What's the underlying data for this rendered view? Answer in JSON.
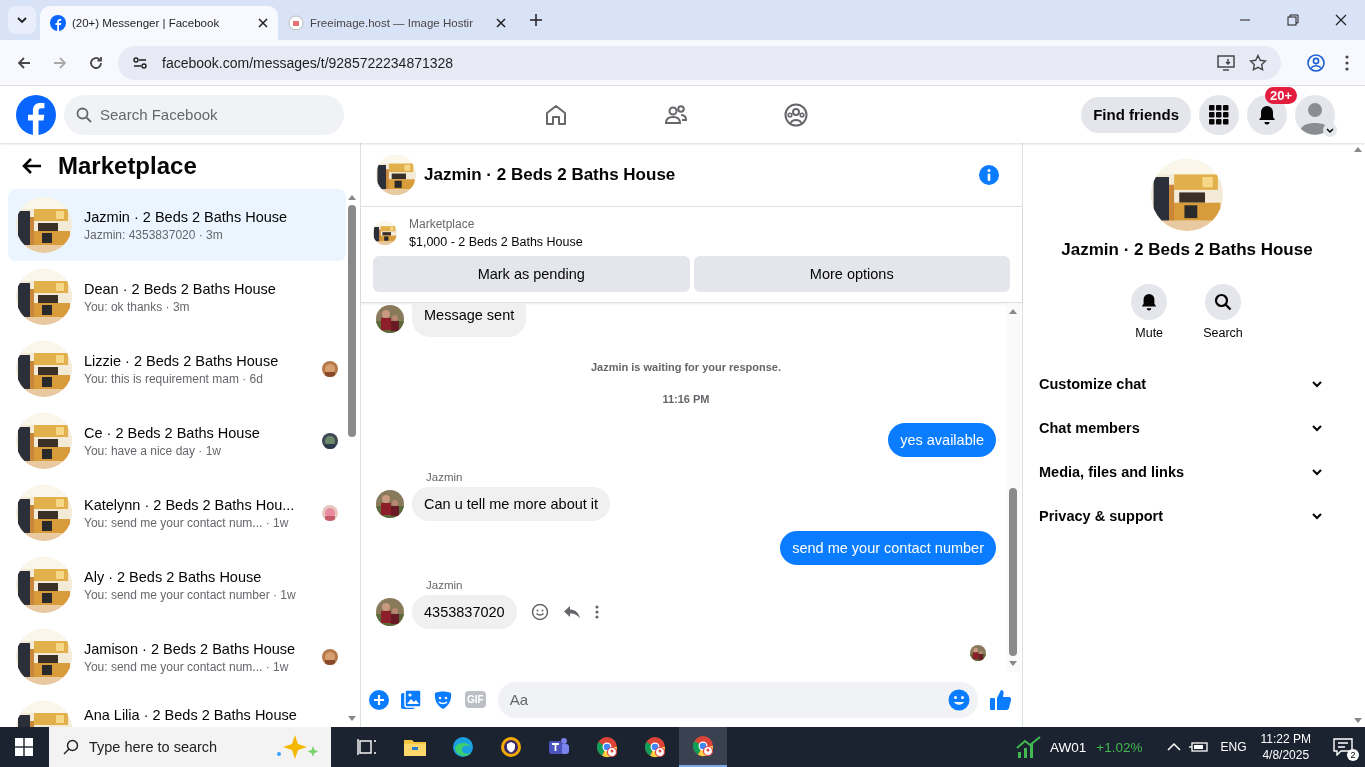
{
  "browser": {
    "tabs": [
      {
        "title": "(20+) Messenger | Facebook",
        "selected": true,
        "kind": "facebook"
      },
      {
        "title": "Freeimage.host — Image Hostir",
        "selected": false,
        "kind": "site"
      }
    ],
    "url": "facebook.com/messages/t/9285722234871328"
  },
  "header": {
    "search": {
      "placeholder": "Search Facebook"
    },
    "find_friends": "Find friends",
    "notification_badge": "20+"
  },
  "sidebar": {
    "title": "Marketplace",
    "conversations": [
      {
        "name": "Jazmin · 2 Beds 2 Baths House",
        "preview": "Jazmin: 4353837020 · 3m",
        "selected": true,
        "seen_avatar": false
      },
      {
        "name": "Dean · 2 Beds 2 Baths House",
        "preview": "You: ok thanks · 3m",
        "selected": false,
        "seen_avatar": false
      },
      {
        "name": "Lizzie · 2 Beds 2 Baths House",
        "preview": "You: this is requirement mam · 6d",
        "selected": false,
        "seen_avatar": true
      },
      {
        "name": "Ce · 2 Beds 2 Baths House",
        "preview": "You: have a nice day · 1w",
        "selected": false,
        "seen_avatar": true
      },
      {
        "name": "Katelynn · 2 Beds 2 Baths Hou...",
        "preview": "You: send me your contact num... · 1w",
        "selected": false,
        "seen_avatar": true
      },
      {
        "name": "Aly · 2 Beds 2 Baths House",
        "preview": "You: send me your contact number · 1w",
        "selected": false,
        "seen_avatar": false
      },
      {
        "name": "Jamison · 2 Beds 2 Baths House",
        "preview": "You: send me your contact num... · 1w",
        "selected": false,
        "seen_avatar": true
      },
      {
        "name": "Ana Lilia · 2 Beds 2 Baths House",
        "selected": false,
        "seen_avatar": false
      }
    ]
  },
  "chat": {
    "title": "Jazmin · 2 Beds 2 Baths House",
    "listing": {
      "label": "Marketplace",
      "title": "$1,000 - 2 Beds 2 Baths House",
      "buttons": [
        "Mark as pending",
        "More options"
      ]
    },
    "messages": [
      {
        "kind": "incoming",
        "text": "Message sent"
      },
      {
        "kind": "notice",
        "text": "Jazmin is waiting for your response."
      },
      {
        "kind": "time",
        "text": "11:16 PM"
      },
      {
        "kind": "outgoing",
        "text": "yes available"
      },
      {
        "kind": "incoming",
        "sender": "Jazmin",
        "text": "Can u tell me more about it"
      },
      {
        "kind": "outgoing",
        "text": "send me your contact number"
      },
      {
        "kind": "incoming",
        "sender": "Jazmin",
        "text": "4353837020",
        "show_actions": true
      }
    ],
    "composer": {
      "placeholder": "Aa",
      "gif_label": "GIF"
    }
  },
  "details": {
    "name": "Jazmin · 2 Beds 2 Baths House",
    "actions": [
      {
        "kind": "mute",
        "label": "Mute"
      },
      {
        "kind": "search",
        "label": "Search"
      }
    ],
    "sections": [
      {
        "label": "Customize chat",
        "expanded": false
      },
      {
        "label": "Chat members",
        "expanded": false
      },
      {
        "label": "Media, files and links",
        "expanded": false
      },
      {
        "label": "Privacy & support",
        "expanded": false
      }
    ]
  },
  "taskbar": {
    "search_placeholder": "Type here to search",
    "apps": [
      {
        "kind": "taskview",
        "selected": false
      },
      {
        "kind": "folder",
        "selected": false
      },
      {
        "kind": "edge",
        "selected": false
      },
      {
        "kind": "vpn",
        "selected": false
      },
      {
        "kind": "teams",
        "selected": false
      },
      {
        "kind": "chrome",
        "selected": false
      },
      {
        "kind": "chrome",
        "selected": false
      },
      {
        "kind": "chrome",
        "selected": true
      }
    ],
    "ticker": {
      "symbol": "AW01",
      "change": "+1.02%"
    },
    "language": "ENG",
    "time": "11:22 PM",
    "date": "4/8/2025",
    "notification_count": "2"
  }
}
